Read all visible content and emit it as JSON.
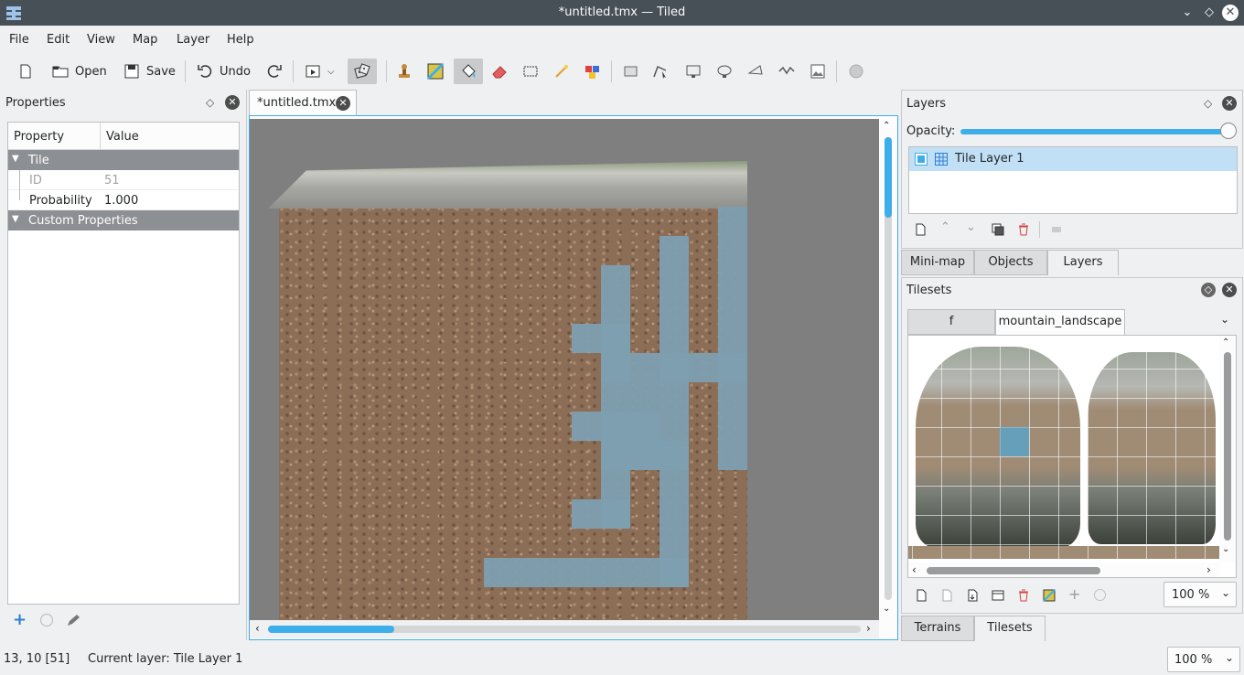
{
  "window": {
    "title": "*untitled.tmx — Tiled"
  },
  "menubar": [
    "File",
    "Edit",
    "View",
    "Map",
    "Layer",
    "Help"
  ],
  "toolbar": {
    "open": "Open",
    "save": "Save",
    "undo": "Undo"
  },
  "properties": {
    "title": "Properties",
    "col_property": "Property",
    "col_value": "Value",
    "group_tile": "Tile",
    "id_label": "ID",
    "id_value": "51",
    "probability_label": "Probability",
    "probability_value": "1.000",
    "group_custom": "Custom Properties"
  },
  "document_tab": "*untitled.tmx",
  "layers": {
    "title": "Layers",
    "opacity_label": "Opacity:",
    "opacity": 1.0,
    "items": [
      {
        "name": "Tile Layer 1",
        "visible": true
      }
    ]
  },
  "dock_tabs_top": [
    "Mini-map",
    "Objects",
    "Layers"
  ],
  "tilesets": {
    "title": "Tilesets",
    "tabs": [
      "f",
      "mountain_landscape"
    ],
    "zoom": "100 %"
  },
  "dock_tabs_bottom": [
    "Terrains",
    "Tilesets"
  ],
  "status": {
    "position": "13, 10 [51]",
    "layer": "Current layer: Tile Layer 1",
    "zoom": "100 %"
  },
  "colors": {
    "accent": "#3daee9",
    "titlebar": "#475057",
    "selection": "#c2e0f5",
    "water": "#7d9fb0"
  }
}
